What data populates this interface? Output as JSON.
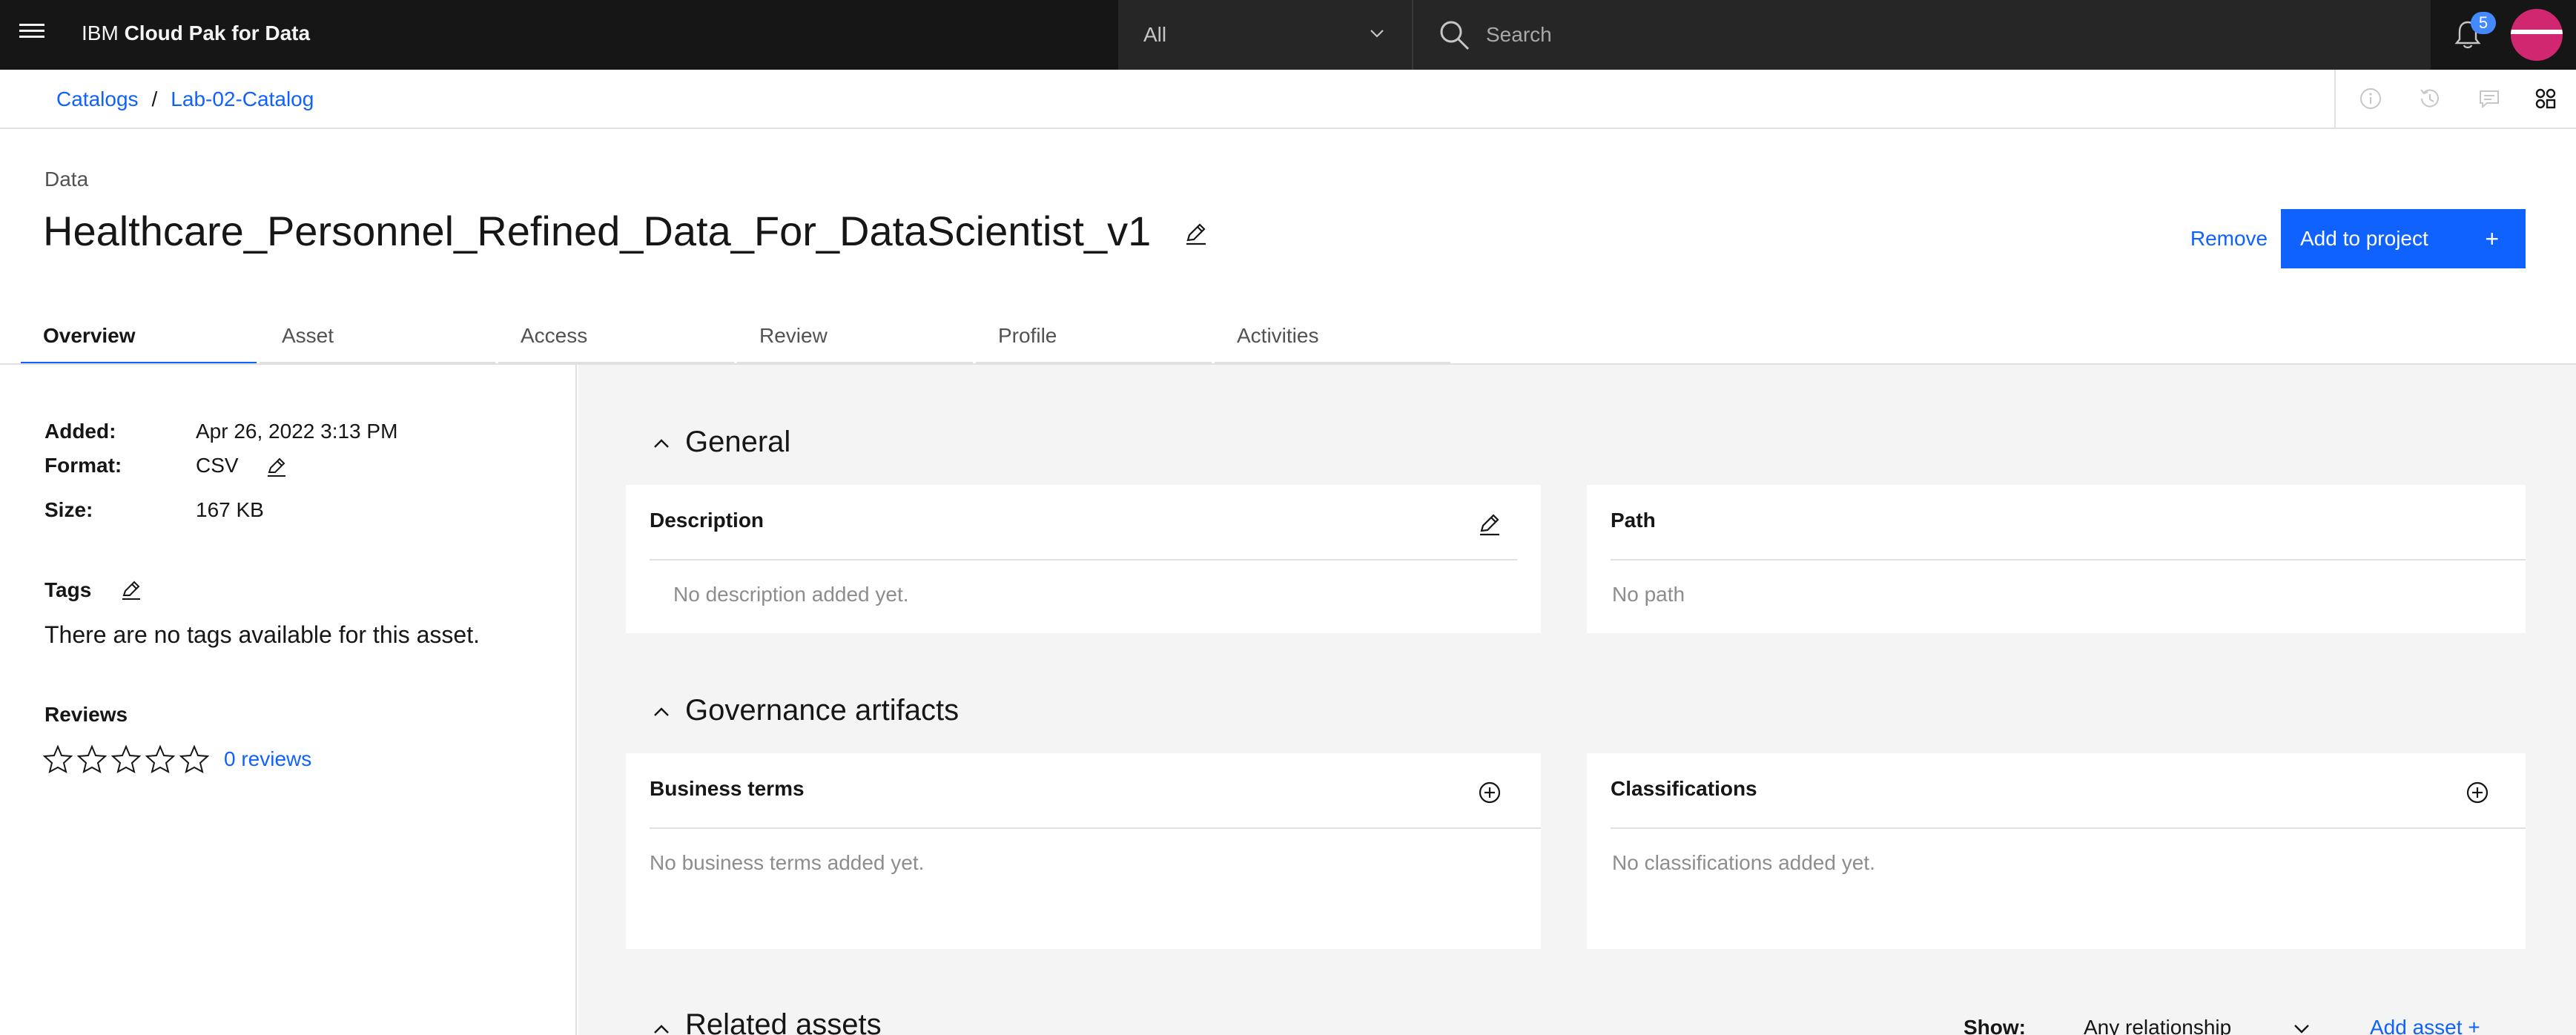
{
  "header": {
    "brand_prefix": "IBM ",
    "brand_name": "Cloud Pak for Data",
    "scope_value": "All",
    "search_placeholder": "Search",
    "notification_count": "5"
  },
  "breadcrumb": {
    "items": [
      "Catalogs",
      "Lab-02-Catalog"
    ],
    "separator": "/"
  },
  "asset": {
    "eyebrow": "Data",
    "title": "Healthcare_Personnel_Refined_Data_For_DataScientist_v1",
    "remove_label": "Remove",
    "add_label": "Add to project",
    "add_symbol": "+"
  },
  "tabs": [
    {
      "label": "Overview",
      "active": true
    },
    {
      "label": "Asset",
      "active": false
    },
    {
      "label": "Access",
      "active": false
    },
    {
      "label": "Review",
      "active": false
    },
    {
      "label": "Profile",
      "active": false
    },
    {
      "label": "Activities",
      "active": false
    }
  ],
  "details": {
    "added_label": "Added:",
    "added_value": "Apr 26, 2022 3:13 PM",
    "format_label": "Format:",
    "format_value": "CSV",
    "size_label": "Size:",
    "size_value": "167 KB"
  },
  "tags": {
    "label": "Tags",
    "empty_text": "There are no tags available for this asset."
  },
  "reviews": {
    "label": "Reviews",
    "rating": 0,
    "max_rating": 5,
    "link_text": "0 reviews"
  },
  "general": {
    "heading": "General",
    "description_title": "Description",
    "description_empty": "No description added yet.",
    "path_title": "Path",
    "path_empty": "No path"
  },
  "governance": {
    "heading": "Governance artifacts",
    "terms_title": "Business terms",
    "terms_empty": "No business terms added yet.",
    "class_title": "Classifications",
    "class_empty": "No classifications added yet."
  },
  "related": {
    "heading": "Related assets",
    "show_label": "Show:",
    "relationship_value": "Any relationship",
    "add_label": "Add asset",
    "add_symbol": "+"
  },
  "colors": {
    "header_bg": "#161616",
    "accent": "#0f62fe",
    "main_bg": "#f4f4f4",
    "avatar": "#d12771"
  }
}
